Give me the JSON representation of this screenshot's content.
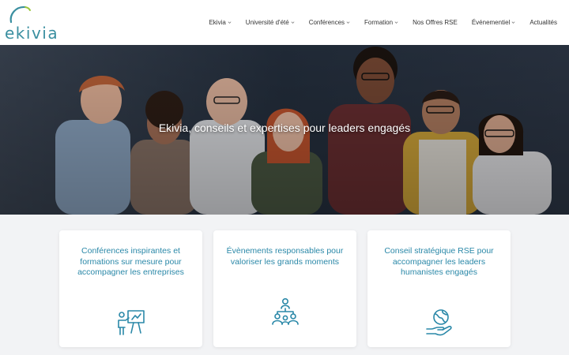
{
  "brand": {
    "logo_text": "ekivia",
    "accent": "#2a88a8"
  },
  "nav": {
    "items": [
      {
        "label": "Ekivia",
        "has_dropdown": true
      },
      {
        "label": "Université d'été",
        "has_dropdown": true
      },
      {
        "label": "Conférences",
        "has_dropdown": true
      },
      {
        "label": "Formation",
        "has_dropdown": true
      },
      {
        "label": "Nos Offres RSE",
        "has_dropdown": false
      },
      {
        "label": "Événementiel",
        "has_dropdown": true
      },
      {
        "label": "Actualités",
        "has_dropdown": false
      }
    ]
  },
  "hero": {
    "title": "Ekivia, conseils et expertises pour leaders engagés"
  },
  "cards": [
    {
      "text": "Conférences inspirantes et formations sur mesure pour accompagner les entreprises",
      "icon": "presentation-icon"
    },
    {
      "text": "Évènements responsables pour valoriser les grands moments",
      "icon": "network-people-icon"
    },
    {
      "text": "Conseil stratégique RSE pour accompagner les leaders humanistes engagés",
      "icon": "globe-hand-icon"
    }
  ]
}
